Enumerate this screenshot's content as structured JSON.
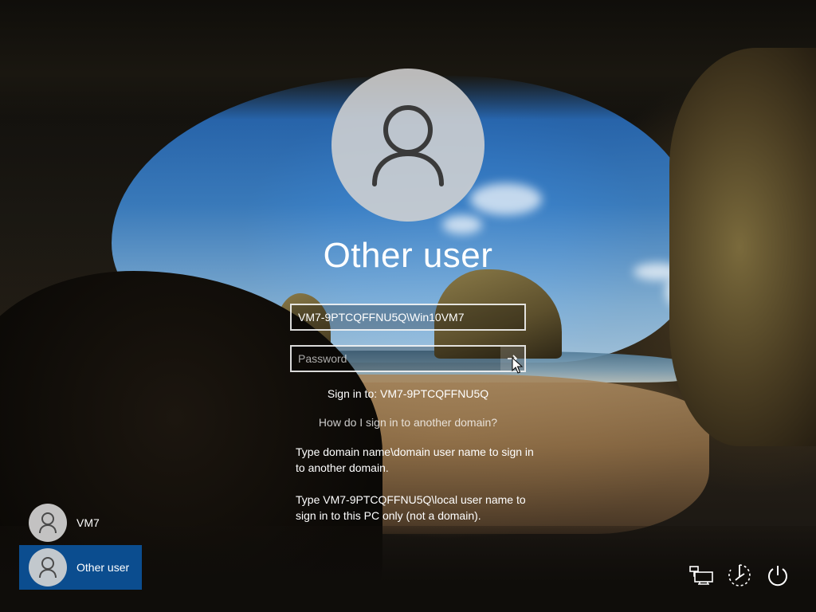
{
  "login": {
    "display_name": "Other user",
    "username_value": "VM7-9PTCQFFNU5Q\\Win10VM7",
    "password_placeholder": "Password",
    "sign_in_to": "Sign in to: VM7-9PTCQFFNU5Q",
    "domain_link": "How do I sign in to another domain?",
    "help_line_1": "Type domain name\\domain user name to sign in to another domain.",
    "help_line_2": "Type VM7-9PTCQFFNU5Q\\local user name to sign in to this PC only (not a domain)."
  },
  "users": [
    {
      "label": "VM7",
      "selected": false
    },
    {
      "label": "Other user",
      "selected": true
    }
  ],
  "system_icons": {
    "network": "network-icon",
    "accessibility": "ease-of-access-icon",
    "power": "power-icon"
  },
  "colors": {
    "selected_tile": "#0b4d8f",
    "text": "#ffffff"
  }
}
